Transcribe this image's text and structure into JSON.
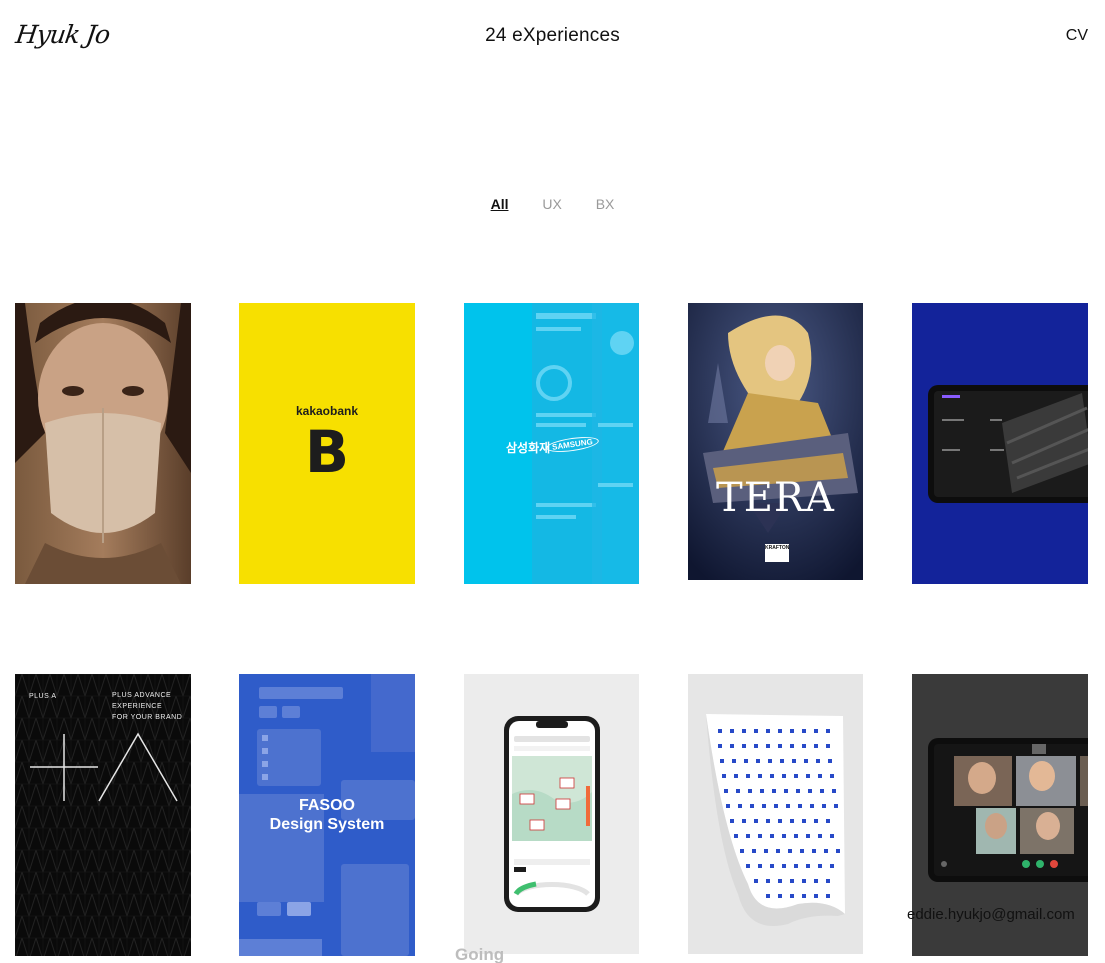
{
  "header": {
    "logo_text": "Hyuk Jo",
    "title": "24 eXperiences",
    "cv_label": "CV"
  },
  "filters": [
    {
      "label": "All",
      "active": true
    },
    {
      "label": "UX",
      "active": false
    },
    {
      "label": "BX",
      "active": false
    }
  ],
  "projects": {
    "kakaobank": {
      "brand_text": "kakaobank",
      "letter": "B"
    },
    "samsung": {
      "korean_name": "삼성화재",
      "brand": "SAMSUNG"
    },
    "tera": {
      "title": "TERA",
      "publisher": "KRAFTON"
    },
    "plusa": {
      "left_text": "PLUS A",
      "tagline": [
        "PLUS ADVANCE",
        "EXPERIENCE",
        "FOR YOUR BRAND"
      ]
    },
    "fasoo": {
      "title_line1": "FASOO",
      "title_line2": "Design System"
    }
  },
  "footer": {
    "going_text": "Going",
    "email": "eddie.hyukjo@gmail.com"
  },
  "colors": {
    "kakao_yellow": "#f7e000",
    "samsung_cyan": "#00c3ec",
    "deep_blue": "#13239a",
    "fasoo_blue": "#2f5cc9"
  }
}
